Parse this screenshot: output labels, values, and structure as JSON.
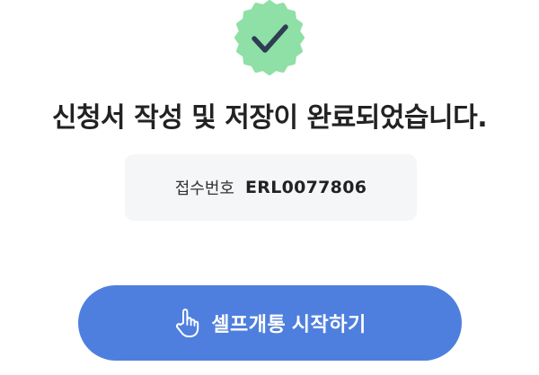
{
  "success_badge": {
    "icon": "check-icon",
    "badge_color": "#8ee0a6",
    "check_color": "#2f3d52"
  },
  "title": "신청서 작성 및 저장이 완료되었습니다.",
  "receipt": {
    "label": "접수번호",
    "number": "ERL0077806"
  },
  "cta": {
    "icon": "hand-pointer-icon",
    "label": "셀프개통 시작하기",
    "color": "#4f7fde"
  }
}
